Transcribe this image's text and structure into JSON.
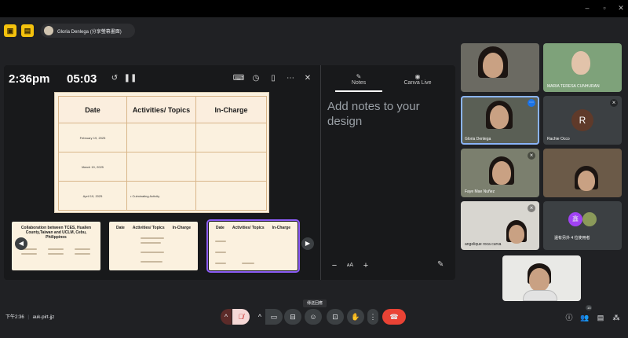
{
  "presenter": {
    "name": "Gloria Denlega (分享螢幕畫面)"
  },
  "canva": {
    "clock": "2:36pm",
    "timer": "05:03",
    "table": {
      "headers": [
        "Date",
        "Activities/ Topics",
        "In-Charge"
      ],
      "rows": [
        {
          "date": "February 19, 2025",
          "activity": ""
        },
        {
          "date": "March 19, 2025",
          "activity": ""
        },
        {
          "date": "April 19, 2025",
          "activity": "• Culminating Activity"
        }
      ]
    },
    "thumb1_title": "Collaboration between TCES, Hualien County,Taiwan and UCLM, Cebu, Philippines",
    "thumb2_headers": [
      "Date",
      "Activities/ Topics",
      "In-Charge"
    ],
    "thumb3_headers": [
      "Date",
      "Activities/ Topics",
      "In-Charge"
    ]
  },
  "notes": {
    "tab_notes": "Notes",
    "tab_canva_live": "Canva Live",
    "placeholder": "Add notes to your design"
  },
  "participants": [
    {
      "name": "",
      "label": ""
    },
    {
      "name": "MARIA TERESA CUNHURAN"
    },
    {
      "name": "Gloria Denlega"
    },
    {
      "name": "Rachie Occo",
      "initial": "R"
    },
    {
      "name": "Faye Mae Nuñez"
    },
    {
      "name": ""
    },
    {
      "name": "angelique roca curva"
    },
    {
      "name": "還有另外 4 位使用者"
    }
  ],
  "bottom": {
    "time": "下午2:36",
    "separator": "|",
    "meeting_code": "auk-pirt-jjz",
    "tooltip": "傳送回應",
    "people_count": "13"
  }
}
